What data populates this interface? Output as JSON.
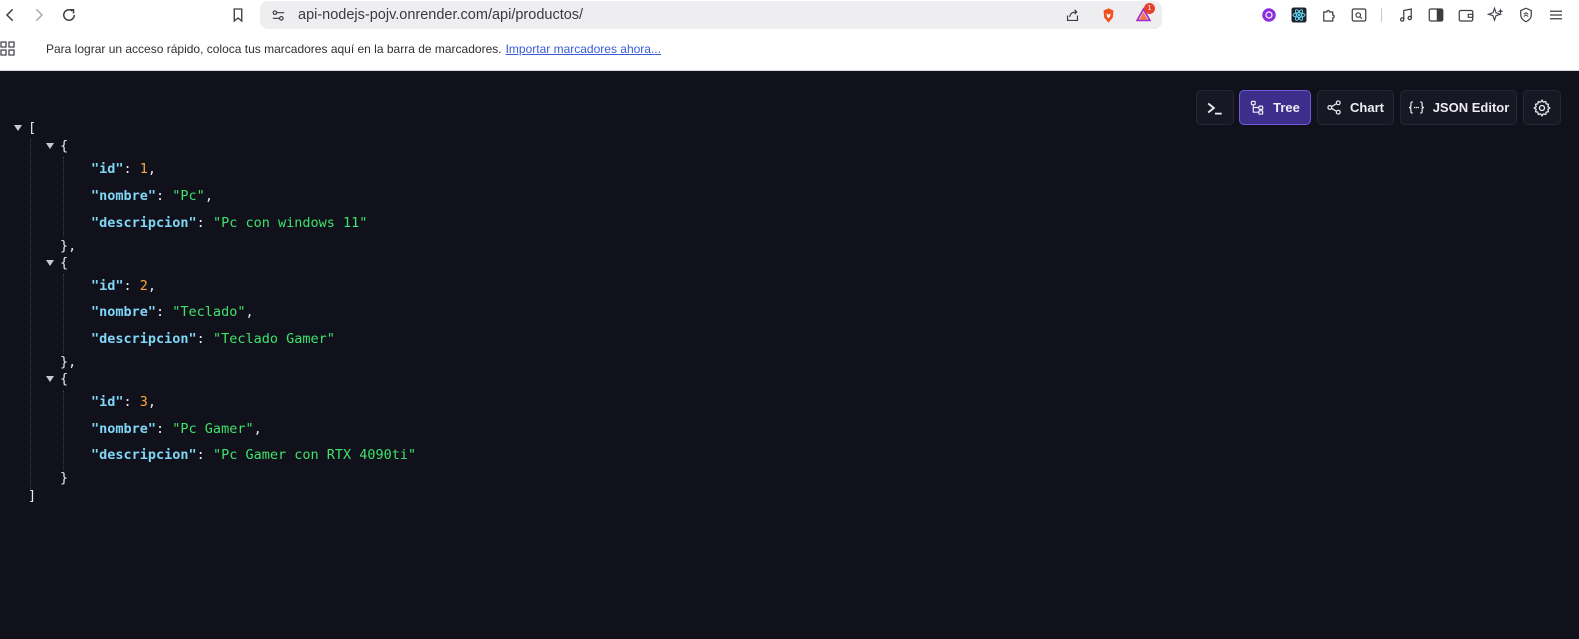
{
  "browser": {
    "url": "api-nodejs-pojv.onrender.com/api/productos/",
    "brave_badge": "1",
    "bookmarks_bar": {
      "message": "Para lograr un acceso rápido, coloca tus marcadores aquí en la barra de marcadores.",
      "link": "Importar marcadores ahora..."
    }
  },
  "viewer": {
    "buttons": {
      "tree": "Tree",
      "chart": "Chart",
      "json_editor": "JSON Editor"
    },
    "active_mode": "Tree"
  },
  "json": {
    "open_bracket": "[",
    "close_bracket": "]",
    "items": [
      {
        "id": "1",
        "nombre": "\"Pc\"",
        "descripcion": "\"Pc con windows 11\""
      },
      {
        "id": "2",
        "nombre": "\"Teclado\"",
        "descripcion": "\"Teclado Gamer\""
      },
      {
        "id": "3",
        "nombre": "\"Pc Gamer\"",
        "descripcion": "\"Pc Gamer con RTX 4090ti\""
      }
    ],
    "keys": {
      "id": "\"id\"",
      "nombre": "\"nombre\"",
      "descripcion": "\"descripcion\""
    }
  },
  "colors": {
    "background": "#11111c",
    "key": "#7fd7f5",
    "number": "#f6a93b",
    "string": "#3ee26a",
    "active_button": "#3d2e8c"
  }
}
